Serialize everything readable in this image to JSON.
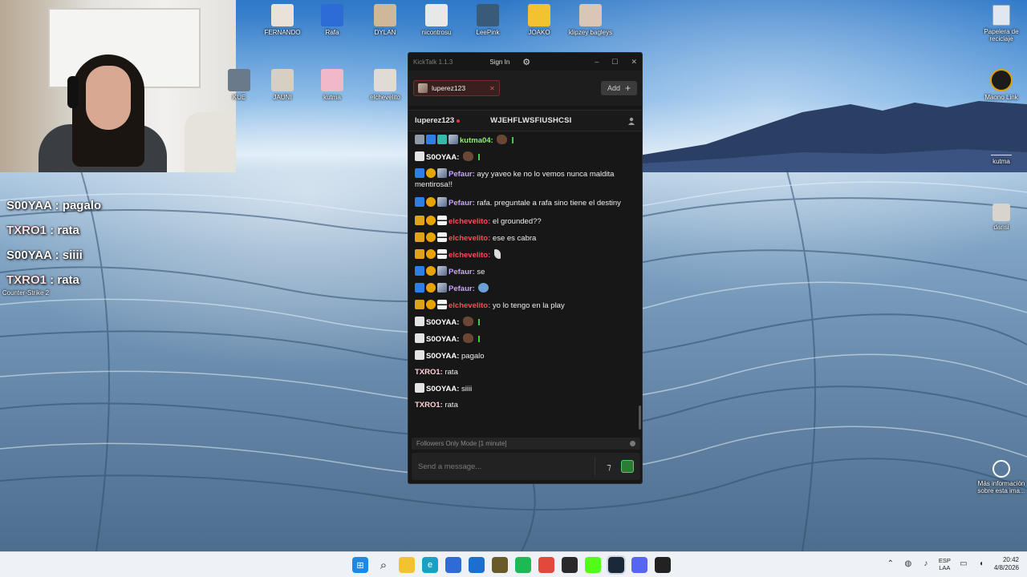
{
  "desktop": {
    "top_icons": [
      {
        "label": "FERNANDO",
        "icon": "cat-photo-icon",
        "color": "#e8e2d8"
      },
      {
        "label": "Rafa",
        "icon": "rocket-league-icon",
        "color": "#2d6bd6"
      },
      {
        "label": "DYLAN",
        "icon": "photo-icon",
        "color": "#cdb89a"
      },
      {
        "label": "nicontrosu",
        "icon": "person-icon",
        "color": "#e8e8e8"
      },
      {
        "label": "LeePink",
        "icon": "counter-strike-icon",
        "color": "#3a5a7a"
      },
      {
        "label": "JOAKO",
        "icon": "stumble-guys-icon",
        "color": "#f2c230"
      },
      {
        "label": "klipzey bagleys",
        "icon": "photo-icon",
        "color": "#d9c6b6"
      }
    ],
    "second_row_icons": [
      {
        "label": "KUE",
        "icon": "photo-icon",
        "color": "#6a7a8a"
      },
      {
        "label": "JAUNI",
        "icon": "cat-photo-icon",
        "color": "#d6d0c4"
      },
      {
        "label": "kutma",
        "icon": "photo-icon",
        "color": "#f0b8c8"
      },
      {
        "label": "elchevelito",
        "icon": "photo-icon",
        "color": "#e0dcd4"
      }
    ],
    "right_icons": [
      {
        "label": "Papelera de reciclaje",
        "icon": "recycle-bin-icon"
      },
      {
        "label": "Maono Link",
        "icon": "maono-link-icon"
      },
      {
        "label": "kutma",
        "icon": "file-icon"
      },
      {
        "label": "dansi",
        "icon": "cat-photo-icon"
      },
      {
        "label": "Más información sobre esta ima...",
        "icon": "camera-icon"
      }
    ],
    "left_icon": {
      "label": "Counter-Strike 2",
      "icon": "counter-strike-icon"
    }
  },
  "overlay_chat": [
    {
      "user": "S00YAA",
      "text": "pagalo"
    },
    {
      "user": "TXRO1",
      "text": "rata"
    },
    {
      "user": "S00YAA",
      "text": "siiii"
    },
    {
      "user": "TXRO1",
      "text": "rata"
    }
  ],
  "kicktalk": {
    "title": "KickTalk 1.1.3",
    "sign_in": "Sign In",
    "tab_label": "luperez123",
    "add_label": "Add",
    "channel": "luperez123",
    "stream_title": "WJEHFLWSFIUSHCSI",
    "messages": [
      {
        "user": "kutma04:",
        "text": "",
        "color": "green",
        "badges": [
          "b-game",
          "b-verified",
          "b-grid",
          "b-pic"
        ],
        "emote": "brown",
        "green_dot": true
      },
      {
        "user": "S0OYAA:",
        "text": "",
        "color": "white",
        "badges": [
          "b-bot"
        ],
        "emote": "brown",
        "green_dot": true
      },
      {
        "user": "Pefaur:",
        "text": "ayy yaveo ke no lo vemos nunca maldita mentirosa!!",
        "color": "purple",
        "badges": [
          "b-verified",
          "b-sub",
          "b-pic"
        ]
      },
      {
        "user": "Pefaur:",
        "text": "rafa. preguntale a rafa sino tiene el destiny",
        "color": "purple",
        "badges": [
          "b-verified",
          "b-sub",
          "b-pic"
        ]
      },
      {
        "user": "elchevelito:",
        "text": "el grounded??",
        "color": "red",
        "badges": [
          "b-crown",
          "b-sub",
          "b-mask"
        ]
      },
      {
        "user": "elchevelito:",
        "text": "ese es cabra",
        "color": "red",
        "badges": [
          "b-crown",
          "b-sub",
          "b-mask"
        ]
      },
      {
        "user": "elchevelito:",
        "text": "",
        "color": "red",
        "badges": [
          "b-crown",
          "b-sub",
          "b-mask"
        ],
        "emote": "feather"
      },
      {
        "user": "Pefaur:",
        "text": "se",
        "color": "purple",
        "badges": [
          "b-verified",
          "b-sub",
          "b-pic"
        ]
      },
      {
        "user": "Pefaur:",
        "text": "",
        "color": "purple",
        "badges": [
          "b-verified",
          "b-sub",
          "b-pic"
        ],
        "emote": "blue"
      },
      {
        "user": "elchevelito:",
        "text": "yo lo tengo en la play",
        "color": "red",
        "badges": [
          "b-crown",
          "b-sub",
          "b-mask"
        ]
      },
      {
        "user": "S0OYAA:",
        "text": "",
        "color": "white",
        "badges": [
          "b-bot"
        ],
        "emote": "brown",
        "green_dot": true
      },
      {
        "user": "S0OYAA:",
        "text": "",
        "color": "white",
        "badges": [
          "b-bot"
        ],
        "emote": "brown",
        "green_dot": true
      },
      {
        "user": "S0OYAA:",
        "text": "pagalo",
        "color": "white",
        "badges": [
          "b-bot"
        ]
      },
      {
        "user": "TXRO1:",
        "text": "rata",
        "color": "pink",
        "badges": []
      },
      {
        "user": "S0OYAA:",
        "text": "siiii",
        "color": "white",
        "badges": [
          "b-bot"
        ]
      },
      {
        "user": "TXRO1:",
        "text": "rata",
        "color": "pink",
        "badges": []
      }
    ],
    "mode_text": "Followers Only Mode [1 minute]",
    "input_placeholder": "Send a message..."
  },
  "taskbar": {
    "apps": [
      {
        "name": "start-button",
        "color": "#1e88e5",
        "glyph": "⊞"
      },
      {
        "name": "search-button",
        "color": "transparent",
        "glyph": "⌕"
      },
      {
        "name": "file-explorer",
        "color": "#f2c230",
        "glyph": ""
      },
      {
        "name": "edge",
        "color": "#1aa0c4",
        "glyph": "e"
      },
      {
        "name": "store",
        "color": "#2f6bd6",
        "glyph": ""
      },
      {
        "name": "outlook",
        "color": "#1b6fcf",
        "glyph": ""
      },
      {
        "name": "game-app",
        "color": "#6a5a2a",
        "glyph": ""
      },
      {
        "name": "spotify",
        "color": "#1db954",
        "glyph": ""
      },
      {
        "name": "chrome",
        "color": "#e04a3a",
        "glyph": ""
      },
      {
        "name": "obs",
        "color": "#2a2a2a",
        "glyph": ""
      },
      {
        "name": "kick",
        "color": "#53fc18",
        "glyph": ""
      },
      {
        "name": "steam",
        "color": "#1b2838",
        "glyph": ""
      },
      {
        "name": "discord",
        "color": "#5865f2",
        "glyph": ""
      },
      {
        "name": "epic-games",
        "color": "#222222",
        "glyph": ""
      }
    ],
    "lang_top": "ESP",
    "lang_bottom": "LAA",
    "time": "20:42",
    "date": "4/8/2026"
  }
}
